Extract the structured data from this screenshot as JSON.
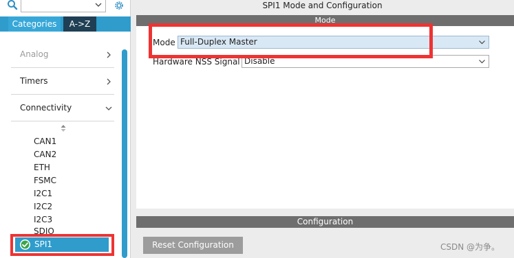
{
  "sidebar": {
    "search": {
      "value": ""
    },
    "tabs": [
      {
        "label": "Categories",
        "active": true
      },
      {
        "label": "A->Z",
        "active": false
      }
    ],
    "categories": [
      {
        "label": "Analog",
        "state": "collapsed",
        "disabled": true
      },
      {
        "label": "Timers",
        "state": "collapsed",
        "disabled": false
      },
      {
        "label": "Connectivity",
        "state": "expanded",
        "disabled": false
      }
    ],
    "peripherals": [
      "CAN1",
      "CAN2",
      "ETH",
      "FSMC",
      "I2C1",
      "I2C2",
      "I2C3",
      "SDIO"
    ],
    "selected_peripheral": {
      "label": "SPI1",
      "status": "configured"
    }
  },
  "main": {
    "title": "SPI1 Mode and Configuration",
    "mode_section": {
      "header": "Mode",
      "fields": [
        {
          "label": "Mode",
          "value": "Full-Duplex Master"
        },
        {
          "label": "Hardware NSS Signal",
          "value": "Disable"
        }
      ]
    },
    "configuration_section": {
      "header": "Configuration",
      "reset_button": "Reset Configuration"
    }
  },
  "watermark": "CSDN @为争。",
  "colors": {
    "accent": "#2f9ccc",
    "dark_tab": "#1f3f55",
    "section_header": "#6e6e6e",
    "highlight": "#ee3333",
    "selected_field": "#d9e8f5"
  }
}
